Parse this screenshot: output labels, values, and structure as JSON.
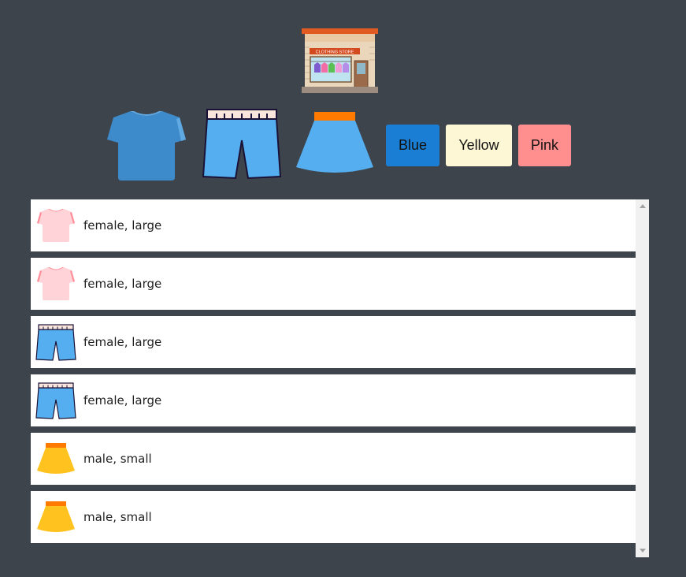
{
  "store": {
    "sign_text": "CLOTHING STORE",
    "icon": "clothing-store-icon"
  },
  "filters": {
    "categories": [
      {
        "icon": "tshirt-icon",
        "color": "#3d8bcb"
      },
      {
        "icon": "shorts-icon",
        "color": "#55aeef"
      },
      {
        "icon": "skirt-icon",
        "color": "#55aeef"
      }
    ],
    "colors": [
      {
        "label": "Blue",
        "hex": "#1a7fd4"
      },
      {
        "label": "Yellow",
        "hex": "#fdf7d6"
      },
      {
        "label": "Pink",
        "hex": "#ff8e8e"
      }
    ]
  },
  "items": [
    {
      "icon": "tshirt-icon",
      "color": "#ffd3d8",
      "text": "female, large"
    },
    {
      "icon": "tshirt-icon",
      "color": "#ffd3d8",
      "text": "female, large"
    },
    {
      "icon": "shorts-icon",
      "color": "#55aeef",
      "text": "female, large"
    },
    {
      "icon": "shorts-icon",
      "color": "#55aeef",
      "text": "female, large"
    },
    {
      "icon": "skirt-icon",
      "color": "#ffc21f",
      "text": "male, small"
    },
    {
      "icon": "skirt-icon",
      "color": "#ffc21f",
      "text": "male, small"
    }
  ]
}
